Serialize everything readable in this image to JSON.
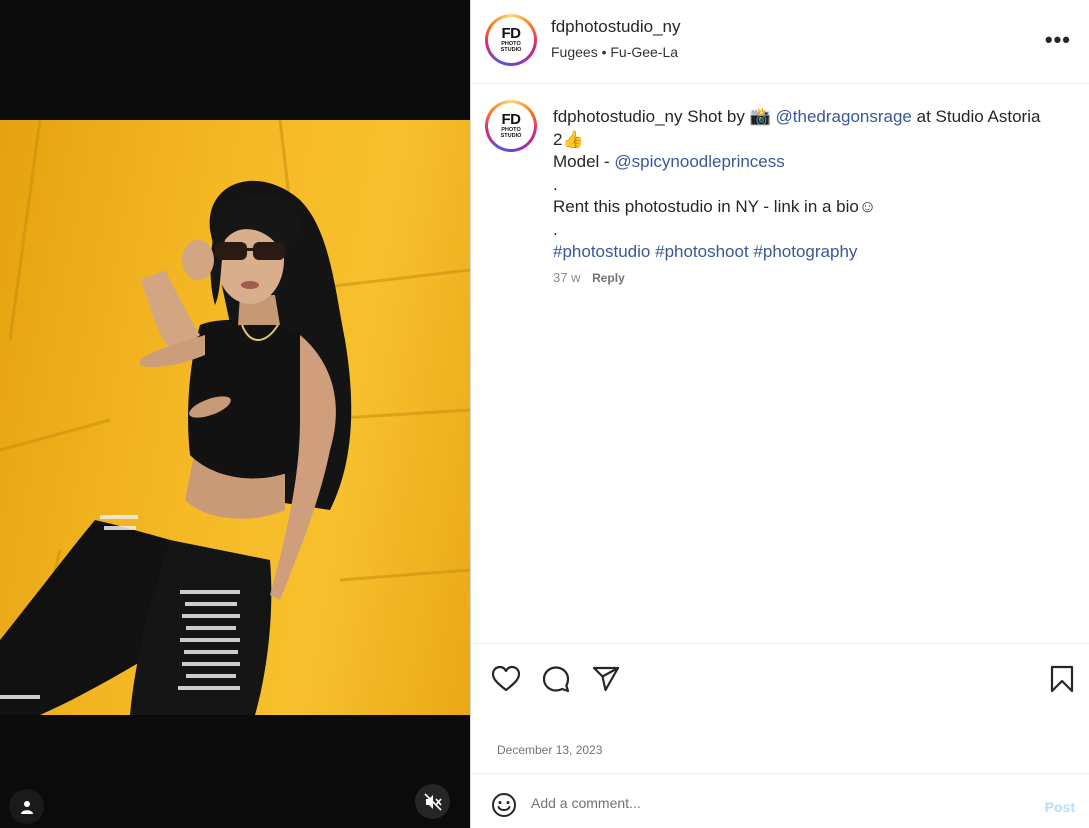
{
  "post": {
    "username": "fdphotostudio_ny",
    "audio": "Fugees • Fu-Gee-La",
    "avatar": {
      "big": "FD",
      "sub_line1": "PHOTO",
      "sub_line2": "STUDIO"
    },
    "caption": {
      "username": "fdphotostudio_ny",
      "text_shot_by": "Shot by",
      "camera_emoji": "📸",
      "photographer": "@thedragonsrage",
      "text_at_studio": "at Studio Astoria 2👍",
      "model_label": "Model -",
      "model_handle": "@spicynoodleprincess",
      "dot1": ".",
      "rent_line": "Rent this photostudio in NY - link in a bio☺",
      "dot2": ".",
      "hashtags": [
        "#photostudio",
        "#photoshoot",
        "#photography"
      ],
      "age": "37 w",
      "reply_label": "Reply"
    },
    "date": "December 13, 2023"
  },
  "comment_bar": {
    "placeholder": "Add a comment...",
    "post_label": "Post"
  },
  "icons": {
    "more": "more-options-icon",
    "like": "heart-icon",
    "comment": "comment-icon",
    "share": "share-icon",
    "save": "bookmark-icon",
    "emoji": "emoji-icon",
    "tags": "user-tag-icon",
    "mute": "muted-speaker-icon"
  },
  "colors": {
    "link": "#385898",
    "post_disabled": "#b2dffc",
    "media_bg": "#0b0b0b",
    "photo_bg": "#f4b824"
  }
}
